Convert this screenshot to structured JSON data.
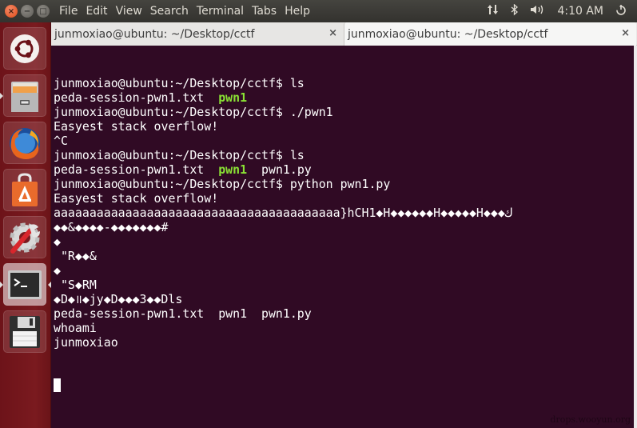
{
  "menu": {
    "items": [
      "File",
      "Edit",
      "View",
      "Search",
      "Terminal",
      "Tabs",
      "Help"
    ]
  },
  "window_controls": {
    "close": "×",
    "minimize": "−",
    "maximize": "□"
  },
  "indicators": {
    "network_icon": "⇅",
    "bluetooth_icon": "✱",
    "volume_icon": "🔊",
    "time": "4:10 AM",
    "power_icon": "⏻"
  },
  "launcher": {
    "items": [
      {
        "name": "ubuntu-dash",
        "label": "Search your computer"
      },
      {
        "name": "files",
        "label": "Files"
      },
      {
        "name": "firefox",
        "label": "Firefox Web Browser"
      },
      {
        "name": "software-center",
        "label": "Ubuntu Software Center"
      },
      {
        "name": "system-settings",
        "label": "System Settings"
      },
      {
        "name": "terminal",
        "label": "Terminal",
        "active": true
      },
      {
        "name": "save",
        "label": "Save"
      }
    ]
  },
  "tabs": [
    {
      "title": "junmoxiao@ubuntu: ~/Desktop/cctf",
      "active": false,
      "close": "×"
    },
    {
      "title": "junmoxiao@ubuntu: ~/Desktop/cctf",
      "active": true,
      "close": "×"
    }
  ],
  "terminal": {
    "lines": [
      [
        {
          "t": "junmoxiao@ubuntu:~/Desktop/cctf$ ls"
        }
      ],
      [
        {
          "t": "peda-session-pwn1.txt  "
        },
        {
          "t": "pwn1",
          "c": "green"
        }
      ],
      [
        {
          "t": "junmoxiao@ubuntu:~/Desktop/cctf$ ./pwn1"
        }
      ],
      [
        {
          "t": "Easyest stack overflow!"
        }
      ],
      [
        {
          "t": "^C"
        }
      ],
      [
        {
          "t": "junmoxiao@ubuntu:~/Desktop/cctf$ ls"
        }
      ],
      [
        {
          "t": "peda-session-pwn1.txt  "
        },
        {
          "t": "pwn1",
          "c": "green"
        },
        {
          "t": "  pwn1.py"
        }
      ],
      [
        {
          "t": "junmoxiao@ubuntu:~/Desktop/cctf$ python pwn1.py"
        }
      ],
      [
        {
          "t": "Easyest stack overflow!"
        }
      ],
      [
        {
          "t": "aaaaaaaaaaaaaaaaaaaaaaaaaaaaaaaaaaaaaaaa}hCH1◆H◆◆◆◆◆◆H◆◆◆◆◆H◆◆◆ك"
        }
      ],
      [
        {
          "t": "◆◆&◆◆◆◆-◆◆◆◆◆◆◆#"
        }
      ],
      [
        {
          "t": "◆"
        }
      ],
      [
        {
          "t": " \"R◆◆&"
        }
      ],
      [
        {
          "t": "◆"
        }
      ],
      [
        {
          "t": " \"S◆RM"
        }
      ],
      [
        {
          "t": "◆D◆॥◆jy◆D◆◆◆3◆◆Dls"
        }
      ],
      [
        {
          "t": "peda-session-pwn1.txt  pwn1  pwn1.py"
        }
      ],
      [
        {
          "t": "whoami"
        }
      ],
      [
        {
          "t": "junmoxiao"
        }
      ]
    ]
  },
  "watermark": "drops.wooyun.org"
}
